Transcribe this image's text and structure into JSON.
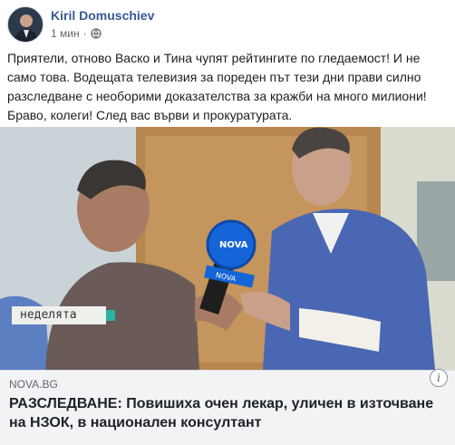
{
  "post": {
    "author": "Kiril Domuschiev",
    "time": "1 мин",
    "separator": "·",
    "privacy_icon": "globe-icon",
    "text": "Приятели, отново Васко и Тина чупят рейтингите по гледаемост! И не само това. Водещата телевизия за пореден път тези дни прави силно разследване с необорими доказателства за кражби на много милиони! Браво, колеги! След вас върви и прокуратурата."
  },
  "media": {
    "tv_label": "неделята",
    "mic_logo": "NOVA",
    "mic_sub": "NOVA"
  },
  "link": {
    "domain": "NOVA.BG",
    "title": "РАЗСЛЕДВАНЕ: Повишиха очен лекар, уличен в източване на НЗОК, в национален консултант",
    "info_icon": "i"
  }
}
